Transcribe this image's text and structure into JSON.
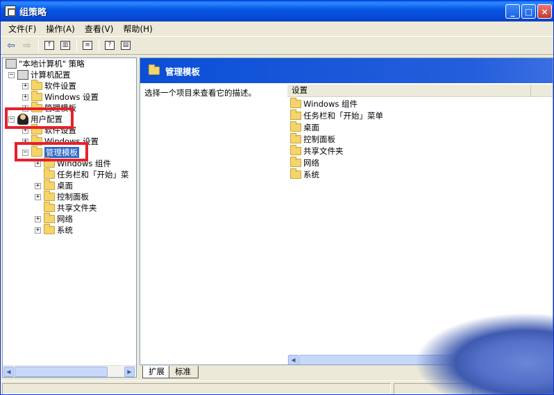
{
  "window": {
    "title": "组策略",
    "controls": {
      "minimize": "_",
      "maximize": "□",
      "close": "×"
    }
  },
  "menu": [
    "文件(F)",
    "操作(A)",
    "查看(V)",
    "帮助(H)"
  ],
  "toolbar": {
    "icons": [
      "back-arrow-icon",
      "forward-arrow-icon",
      "up-folder-icon",
      "show-hide-tree-icon",
      "export-list-icon",
      "help-icon",
      "properties-icon"
    ]
  },
  "tree": {
    "root": "\"本地计算机\" 策略",
    "computer_config": "计算机配置",
    "software_settings_1": "软件设置",
    "windows_settings_1": "Windows 设置",
    "admin_templates_1": "管理模板",
    "user_config": "用户配置",
    "software_settings_2": "软件设置",
    "windows_settings_2": "Windows 设置",
    "admin_templates_2": "管理模板",
    "children": [
      "Windows 组件",
      "任务栏和「开始」菜",
      "桌面",
      "控制面板",
      "共享文件夹",
      "网络",
      "系统"
    ]
  },
  "right": {
    "header_title": "管理模板",
    "description": "选择一个项目来查看它的描述。",
    "column_header": "设置",
    "items": [
      "Windows 组件",
      "任务栏和「开始」菜单",
      "桌面",
      "控制面板",
      "共享文件夹",
      "网络",
      "系统"
    ]
  },
  "tabs": {
    "extended": "扩展",
    "standard": "标准"
  },
  "highlight_color": "#e8202a",
  "accent_color": "#0b4fd6",
  "selection_color": "#316ac5"
}
